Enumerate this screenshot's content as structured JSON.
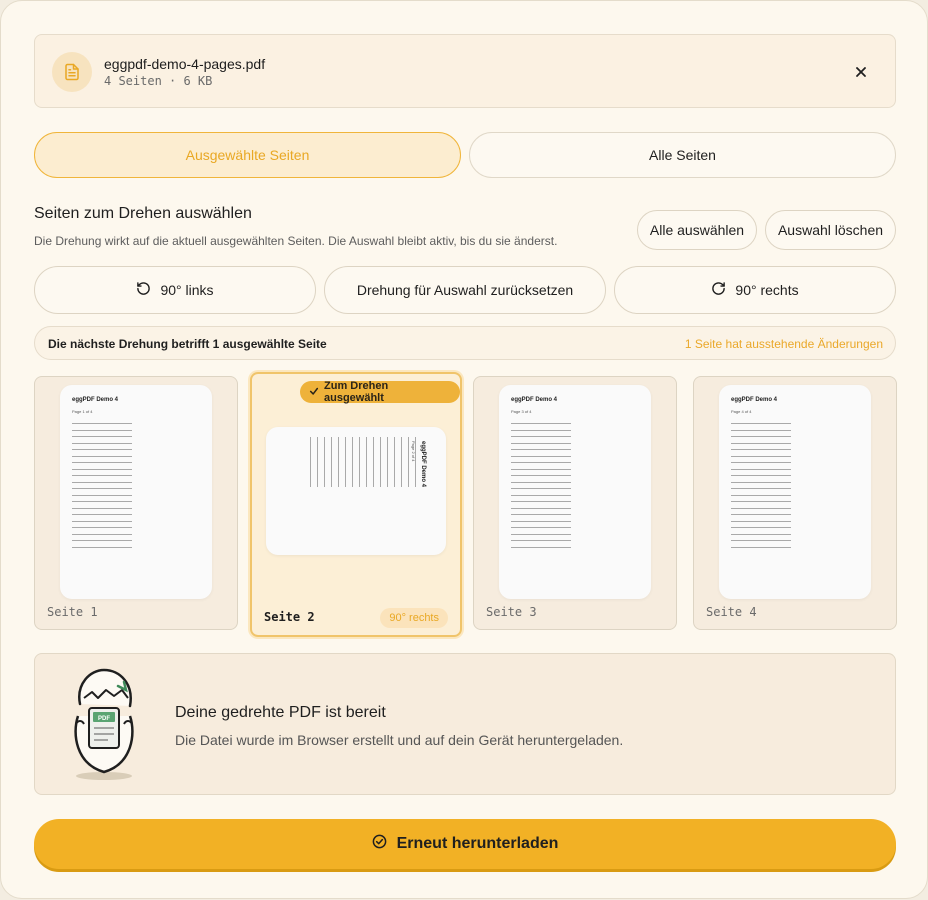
{
  "file": {
    "name": "eggpdf-demo-4-pages.pdf",
    "meta": "4 Seiten · 6 KB",
    "close_icon": "close-icon"
  },
  "mode": {
    "selected_label": "Ausgewählte Seiten",
    "all_label": "Alle Seiten"
  },
  "section": {
    "title": "Seiten zum Drehen auswählen",
    "description": "Die Drehung wirkt auf die aktuell ausgewählten Seiten. Die Auswahl bleibt aktiv, bis du sie änderst.",
    "select_all": "Alle auswählen",
    "clear_selection": "Auswahl löschen"
  },
  "rotation": {
    "left_label": "90° links",
    "reset_label": "Drehung für Auswahl zurücksetzen",
    "right_label": "90° rechts"
  },
  "info": {
    "left": "Die nächste Drehung betrifft 1 ausgewählte Seite",
    "right": "1 Seite hat ausstehende Änderungen"
  },
  "pages": [
    {
      "label": "Seite 1",
      "thumb_title": "eggPDF Demo 4",
      "thumb_sub": "Page 1 of 4"
    },
    {
      "label": "Seite 2",
      "thumb_title": "eggPDF Demo 4",
      "thumb_sub": "Page 2 of 4",
      "badge": "Zum Drehen ausgewählt",
      "rotation": "90° rechts"
    },
    {
      "label": "Seite 3",
      "thumb_title": "eggPDF Demo 4",
      "thumb_sub": "Page 3 of 4"
    },
    {
      "label": "Seite 4",
      "thumb_title": "eggPDF Demo 4",
      "thumb_sub": "Page 4 of 4"
    }
  ],
  "ready": {
    "title": "Deine gedrehte PDF ist bereit",
    "description": "Die Datei wurde im Browser erstellt und auf dein Gerät heruntergeladen.",
    "pdf_tag": "PDF"
  },
  "download": {
    "label": "Erneut herunterladen"
  },
  "colors": {
    "accent": "#f2b125",
    "accent_text": "#e9a824",
    "background": "#fdf8ee"
  }
}
